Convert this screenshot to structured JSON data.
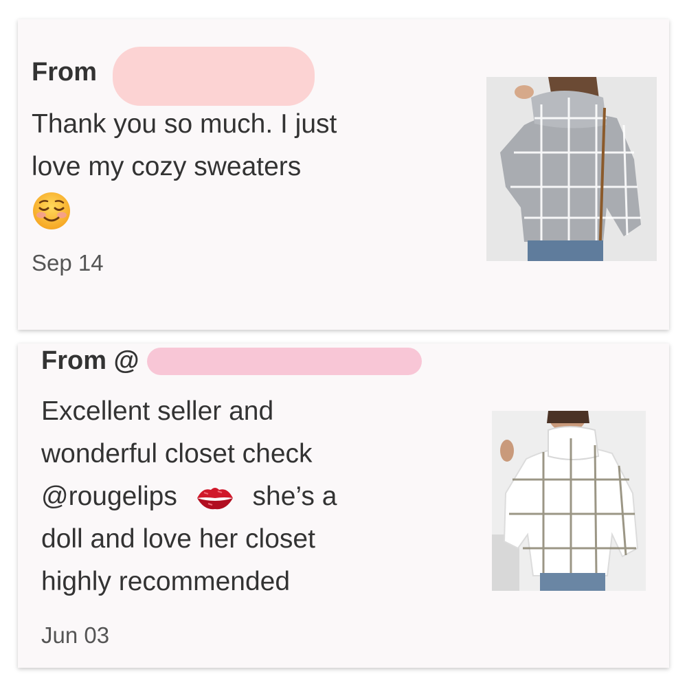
{
  "reviews": [
    {
      "from_label": "From",
      "message_lines": [
        "Thank you so much. I just",
        "love my cozy sweaters"
      ],
      "emoji": "smiling-face-emoji",
      "date": "Sep 14",
      "redaction_color": "#fcd3d3",
      "product_photo": "gray plaid turtleneck sweater"
    },
    {
      "from_label": "From @",
      "message_lines": [
        "Excellent seller and",
        "wonderful closet check",
        "@rougelips",
        "she’s a",
        "doll and love her closet",
        "highly recommended"
      ],
      "emoji": "kiss-mark-emoji",
      "date": "Jun 03",
      "redaction_color": "#f8c6d6",
      "product_photo": "white grid-pattern turtleneck sweater"
    }
  ]
}
